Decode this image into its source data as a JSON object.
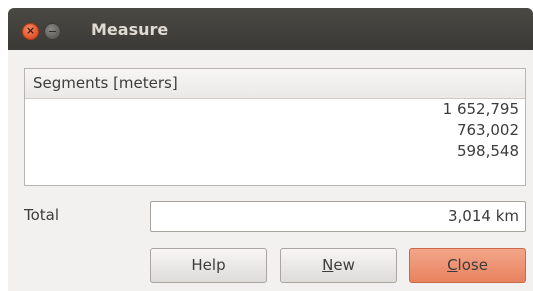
{
  "window": {
    "title": "Measure",
    "close_glyph": "×"
  },
  "table": {
    "header": "Segments [meters]",
    "rows": [
      "1 652,795",
      "763,002",
      "598,548"
    ]
  },
  "total": {
    "label": "Total",
    "value": "3,014 km"
  },
  "buttons": {
    "help": "Help",
    "new_mnemonic": "N",
    "new_rest": "ew",
    "close_mnemonic": "C",
    "close_rest": "lose"
  },
  "colors": {
    "titlebar": "#3c3b37",
    "close_accent": "#e8825f"
  }
}
